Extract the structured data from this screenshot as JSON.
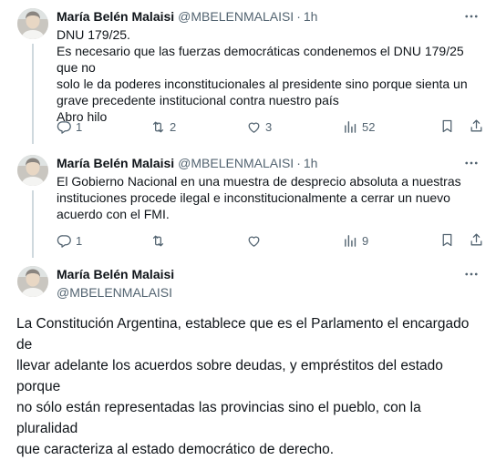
{
  "tweets": [
    {
      "name": "María Belén Malaisi",
      "handle": "@MBELENMALAISI",
      "separator": "·",
      "time": "1h",
      "lines": [
        "DNU 179/25.",
        "Es necesario que las fuerzas democráticas condenemos el DNU 179/25 que no",
        "solo le da poderes inconstitucionales al presidente sino porque sienta un",
        "grave precedente institucional contra nuestro país",
        "Abro hilo"
      ],
      "replies": "1",
      "reposts": "2",
      "likes": "3",
      "views": "52"
    },
    {
      "name": "María Belén Malaisi",
      "handle": "@MBELENMALAISI",
      "separator": "·",
      "time": "1h",
      "lines": [
        "El  Gobierno Nacional en una muestra de desprecio absoluta a nuestras",
        "instituciones procede ilegal e inconstitucionalmente a cerrar un nuevo",
        "acuerdo con el FMI."
      ],
      "replies": "1",
      "reposts": "",
      "likes": "",
      "views": "9"
    }
  ],
  "main_tweet": {
    "name": "María Belén Malaisi",
    "handle": "@MBELENMALAISI",
    "lines": [
      "La Constitución Argentina, establece que es el Parlamento el encargado de",
      "llevar adelante los acuerdos sobre deudas, y empréstitos del estado porque",
      "no sólo están representadas las provincias sino el pueblo, con la pluralidad",
      "que caracteriza al estado democrático de derecho."
    ]
  },
  "icons": {
    "more": "more-horizontal-icon",
    "reply": "reply-icon",
    "repost": "repost-icon",
    "like": "heart-icon",
    "views": "views-chart-icon",
    "bookmark": "bookmark-icon",
    "share": "share-icon"
  },
  "colors": {
    "text": "#0f1419",
    "secondary": "#536471",
    "thread_line": "#cfd9de"
  }
}
